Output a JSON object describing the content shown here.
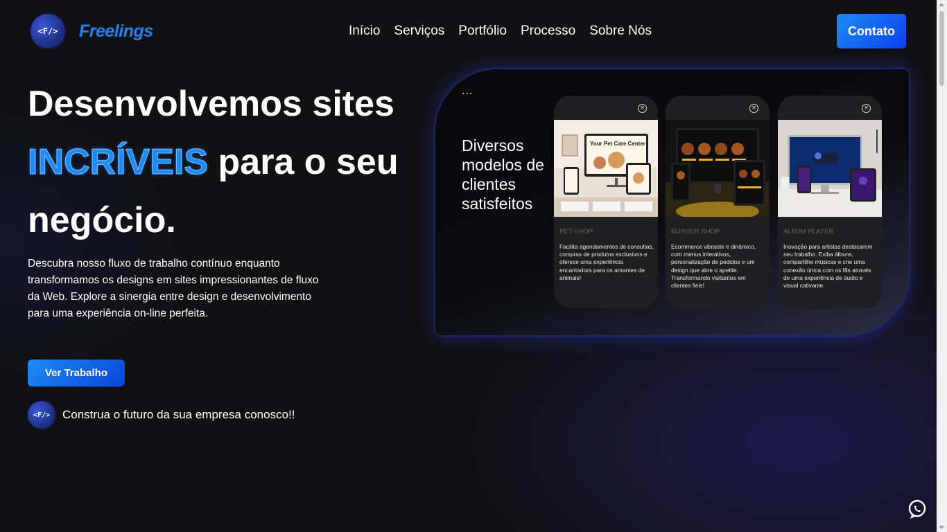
{
  "brand": {
    "name": "Freelings",
    "badge_text": "<F/>"
  },
  "nav": {
    "items": [
      {
        "label": "Início"
      },
      {
        "label": "Serviços"
      },
      {
        "label": "Portfólio"
      },
      {
        "label": "Processo"
      },
      {
        "label": "Sobre Nós"
      }
    ],
    "contact_label": "Contato"
  },
  "hero": {
    "headline_part1": "Desenvolvemos sites",
    "headline_accent": "INCRÍVEIS",
    "headline_part2": "para o seu",
    "headline_part3": "negócio.",
    "lead": "Descubra nosso fluxo de trabalho contínuo enquanto transformamos os designs em sites impressionantes de fluxo da Web. Explore a sinergia entre design e desenvolvimento para uma experiência on-line perfeita.",
    "work_button": "Ver Trabalho",
    "cta_text": "Construa o futuro da sua empresa conosco!!"
  },
  "showcase": {
    "dots": "...",
    "heading": "Diversos modelos de clientes satisfeitos",
    "cards": [
      {
        "category": "PET-SHOP",
        "description": "Facilita agendamentos de consultas, compras de produtos exclusivos e oferece uma experiência encantadora para os amantes de animais!",
        "screen_title": "Your Pet Care Center"
      },
      {
        "category": "BURGER SHOP",
        "description": "Ecommerce vibrante e dinâmico, com menus interativos, personalização de pedidos e um design que abre o apetite. Transformando visitantes em clientes fiéis!"
      },
      {
        "category": "ALBUM PLAYER",
        "description": "Inovação para artistas destacarem seu trabalho. Exiba álbuns, compartilhe músicas e crie uma conexão única com os fãs através de uma experiência de áudio e visual cativante."
      }
    ]
  },
  "icons": {
    "whatsapp": "whatsapp-icon",
    "close": "close-icon"
  },
  "colors": {
    "accent": "#1c8cf3",
    "button_end": "#0a3ff0",
    "background": "#111114"
  }
}
